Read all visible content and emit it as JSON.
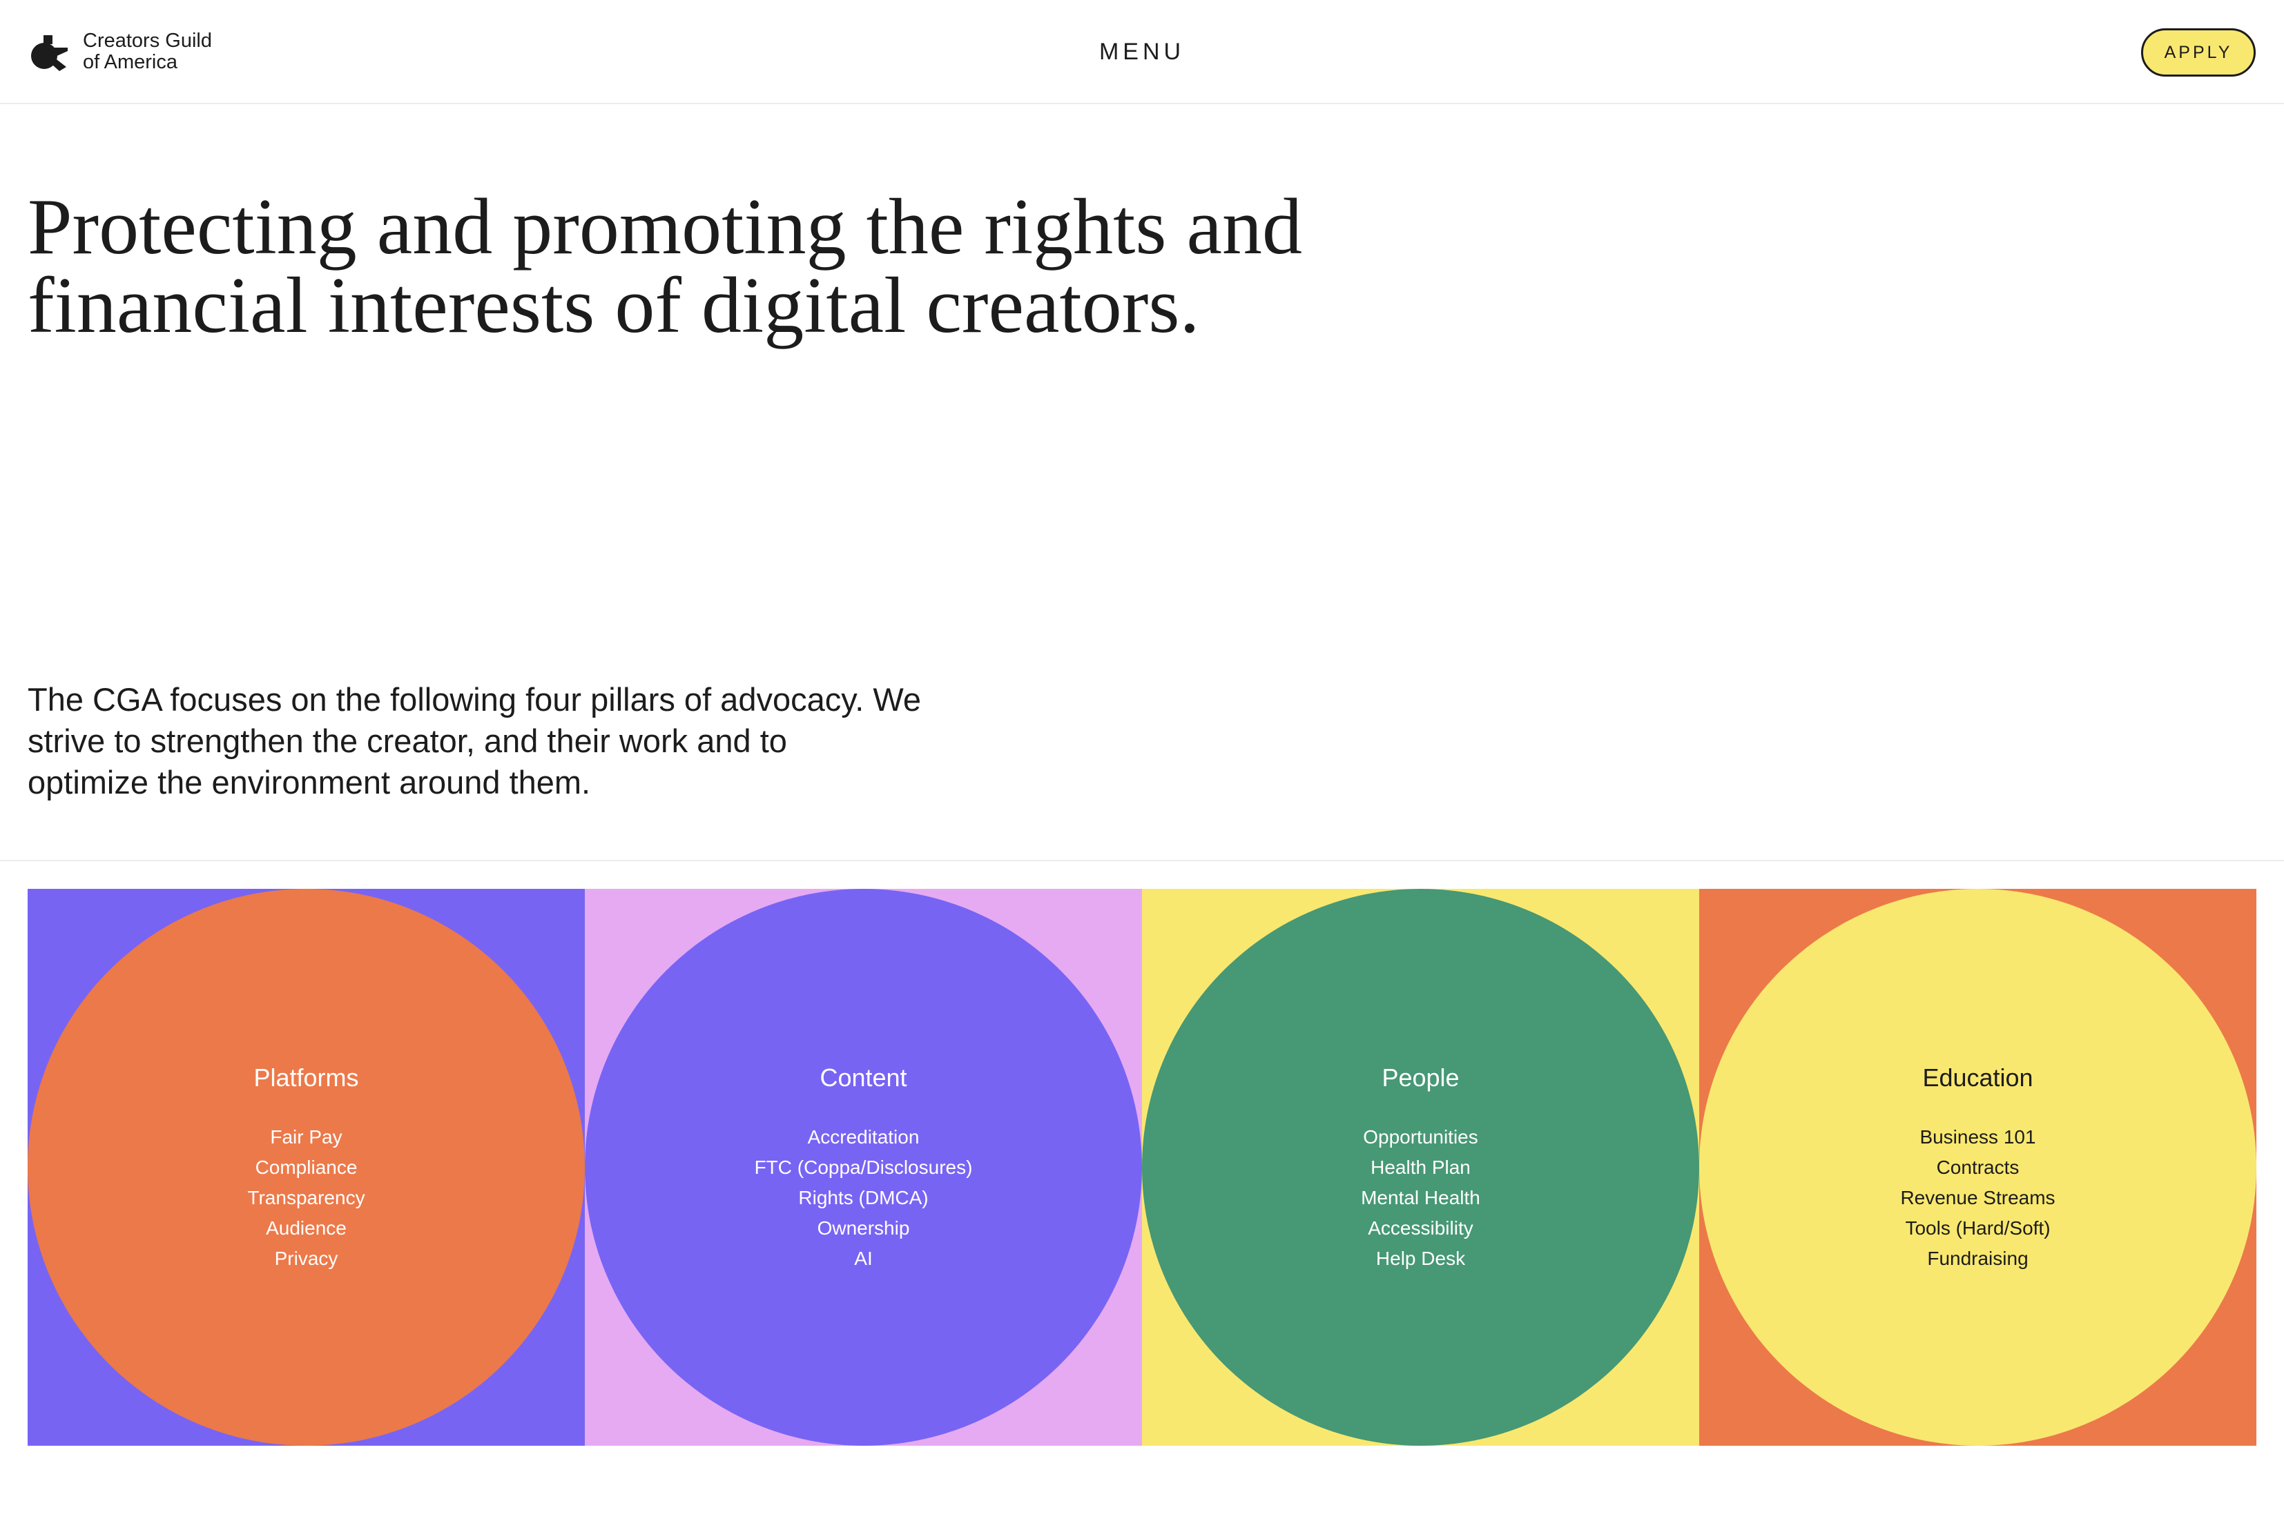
{
  "header": {
    "brand_line1": "Creators Guild",
    "brand_line2": "of America",
    "logo_icon": "cga-logo-icon",
    "menu_label": "MENU",
    "apply_label": "APPLY"
  },
  "hero": {
    "title_line1": "Protecting and promoting the rights and",
    "title_line2": "financial interests of digital creators."
  },
  "intro": {
    "line1": "The CGA focuses on the following four pillars of advocacy. We",
    "line2": "strive to strengthen the creator, and their work and to",
    "line3": "optimize the environment around them."
  },
  "colors": {
    "yellow": "#f9e86f",
    "orange": "#ec794a",
    "purple": "#7864f3",
    "pink": "#e6aaf3",
    "green": "#479875",
    "text": "#1c1c1c"
  },
  "pillars": [
    {
      "title": "Platforms",
      "items": [
        "Fair Pay",
        "Compliance",
        "Transparency",
        "Audience",
        "Privacy"
      ]
    },
    {
      "title": "Content",
      "items": [
        "Accreditation",
        "FTC (Coppa/Disclosures)",
        "Rights (DMCA)",
        "Ownership",
        "AI"
      ]
    },
    {
      "title": "People",
      "items": [
        "Opportunities",
        "Health Plan",
        "Mental Health",
        "Accessibility",
        "Help Desk"
      ]
    },
    {
      "title": "Education",
      "items": [
        "Business 101",
        "Contracts",
        "Revenue Streams",
        "Tools (Hard/Soft)",
        "Fundraising"
      ]
    }
  ]
}
